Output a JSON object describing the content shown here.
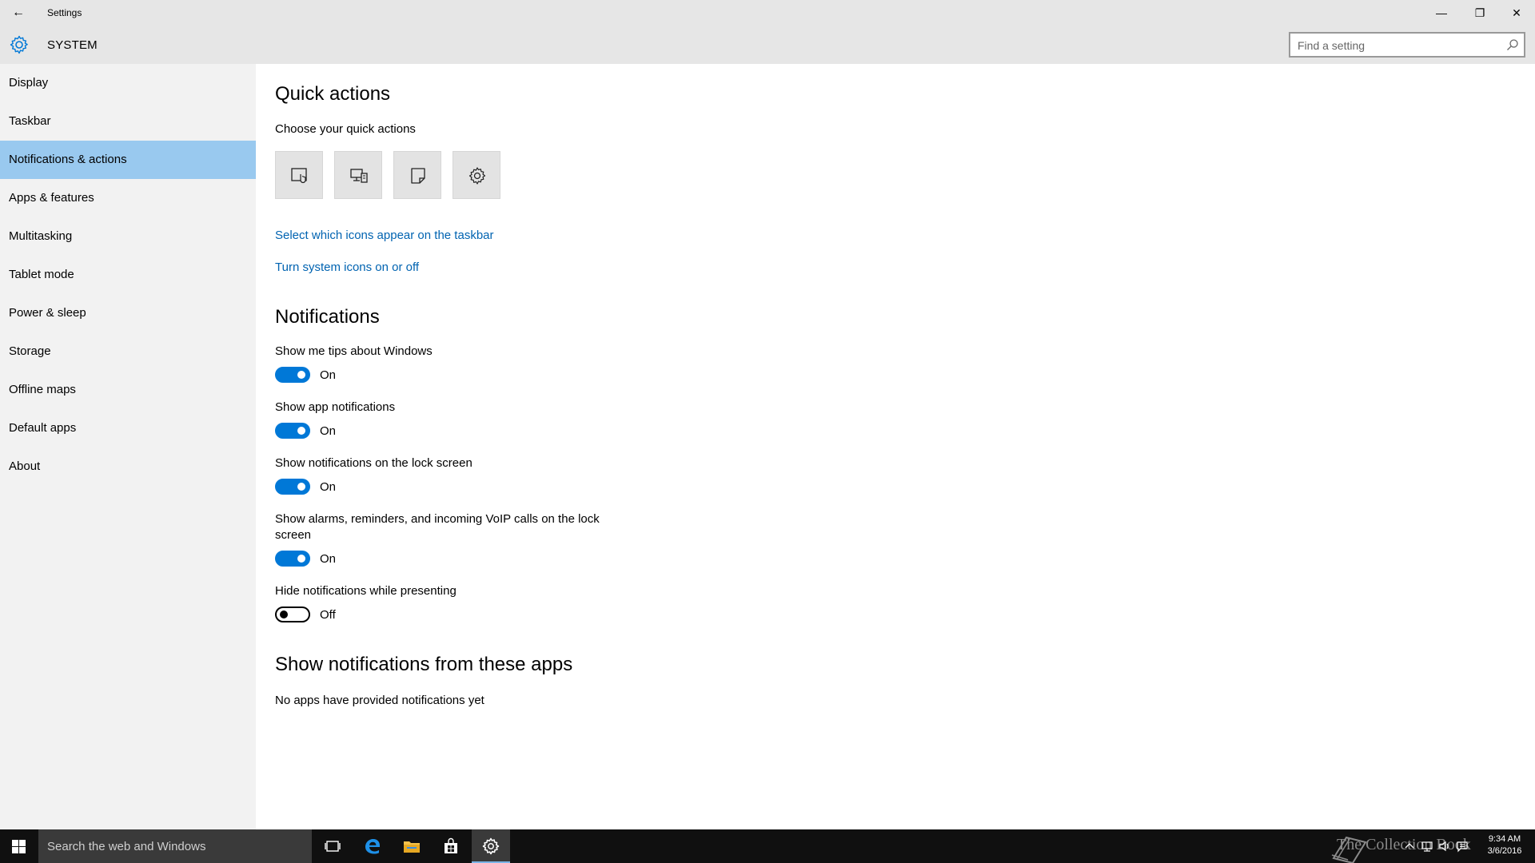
{
  "window": {
    "title": "Settings",
    "back_glyph": "←",
    "minimize_glyph": "—",
    "maximize_glyph": "❐",
    "close_glyph": "✕"
  },
  "header": {
    "section": "SYSTEM",
    "search_placeholder": "Find a setting"
  },
  "sidebar": {
    "items": [
      {
        "label": "Display"
      },
      {
        "label": "Taskbar"
      },
      {
        "label": "Notifications & actions",
        "selected": true
      },
      {
        "label": "Apps & features"
      },
      {
        "label": "Multitasking"
      },
      {
        "label": "Tablet mode"
      },
      {
        "label": "Power & sleep"
      },
      {
        "label": "Storage"
      },
      {
        "label": "Offline maps"
      },
      {
        "label": "Default apps"
      },
      {
        "label": "About"
      }
    ]
  },
  "quick_actions": {
    "heading": "Quick actions",
    "subheading": "Choose your quick actions",
    "tiles": [
      {
        "icon": "tablet-mode-icon"
      },
      {
        "icon": "project-icon"
      },
      {
        "icon": "note-icon"
      },
      {
        "icon": "all-settings-icon"
      }
    ],
    "link_taskbar_icons": "Select which icons appear on the taskbar",
    "link_system_icons": "Turn system icons on or off"
  },
  "notifications": {
    "heading": "Notifications",
    "settings": [
      {
        "label": "Show me tips about Windows",
        "state": "On"
      },
      {
        "label": "Show app notifications",
        "state": "On"
      },
      {
        "label": "Show notifications on the lock screen",
        "state": "On"
      },
      {
        "label_line1": "Show alarms, reminders, and incoming VoIP calls on the lock",
        "label_line2": "screen",
        "state": "On"
      },
      {
        "label": "Hide notifications while presenting",
        "state": "Off"
      }
    ]
  },
  "apps_section": {
    "heading": "Show notifications from these apps",
    "empty_text": "No apps have provided notifications yet"
  },
  "taskbar": {
    "search_placeholder": "Search the web and Windows",
    "watermark": "The Collection Book",
    "time": "9:34 AM",
    "date": "3/6/2016"
  },
  "colors": {
    "accent": "#0078d7",
    "link": "#0063b1",
    "selected_nav": "#99c9ef",
    "chrome": "#e6e6e6",
    "sidebar": "#f2f2f2"
  }
}
